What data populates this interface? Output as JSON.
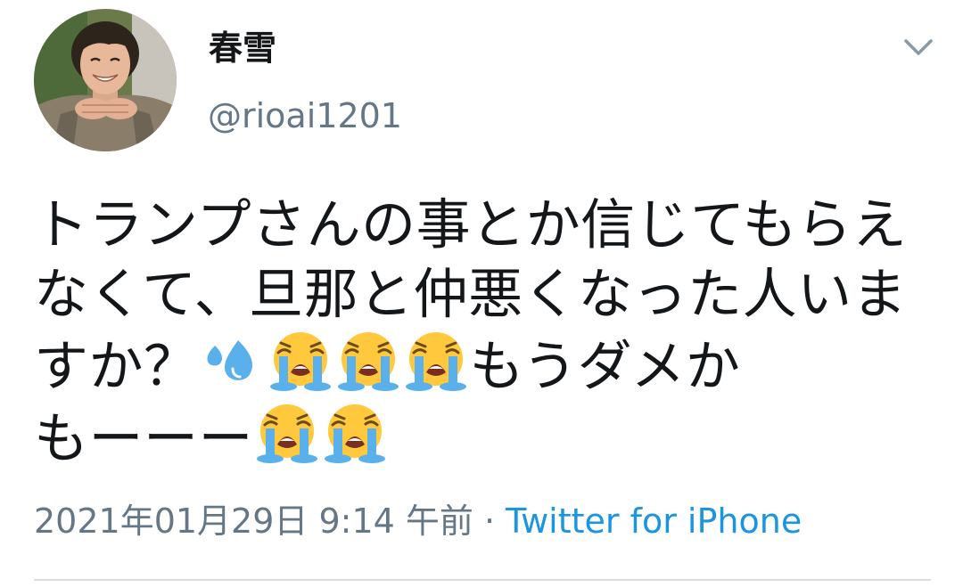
{
  "user": {
    "display_name": "春雪",
    "handle": "@rioai1201",
    "avatar_icon": "profile-photo"
  },
  "menu": {
    "icon": "chevron-down-icon"
  },
  "tweet": {
    "line1": "トランプさんの事とか信じてもらえ",
    "line2": "なくて、旦那と仲悪くなった人いま",
    "line3_text_a": "すか？",
    "line3_text_b": "もうダメか",
    "line4_text": "もーーー",
    "emojis": [
      "sweat-droplets-icon",
      "loudly-crying-face-icon"
    ]
  },
  "meta": {
    "timestamp": "2021年01月29日 9:14 午前",
    "separator": " · ",
    "source": "Twitter for iPhone"
  },
  "colors": {
    "text": "#14171a",
    "secondary": "#657786",
    "link": "#1b95e0",
    "divider": "#d8dde1",
    "emoji_face": "#ffc83d",
    "emoji_tears": "#5ab0ea"
  }
}
